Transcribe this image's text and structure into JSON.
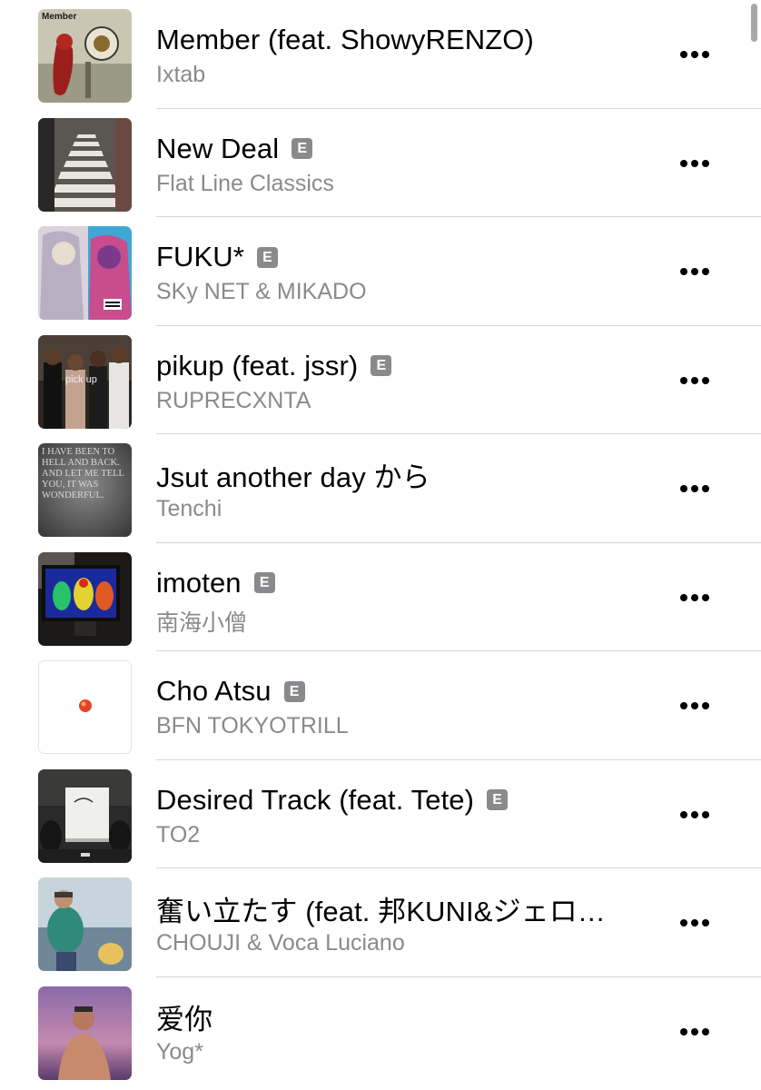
{
  "tracks": [
    {
      "title": "Member (feat. ShowyRENZO)",
      "artist": "Ixtab",
      "explicit": false,
      "artwork_label": "Member"
    },
    {
      "title": "New Deal",
      "artist": "Flat Line Classics",
      "explicit": true,
      "explicit_label": "E"
    },
    {
      "title": "FUKU*",
      "artist": "SKy NET & MIKADO",
      "explicit": true,
      "explicit_label": "E"
    },
    {
      "title": "pikup (feat. jssr)",
      "artist": "RUPRECXNTA",
      "explicit": true,
      "explicit_label": "E",
      "artwork_label": "pick up"
    },
    {
      "title": "Jsut another day から",
      "artist": "Tenchi",
      "explicit": false,
      "artwork_text": "I HAVE BEEN TO HELL AND BACK. AND LET ME TELL YOU, IT WAS WONDERFUL."
    },
    {
      "title": "imoten",
      "artist": "南海小僧",
      "explicit": true,
      "explicit_label": "E"
    },
    {
      "title": "Cho Atsu",
      "artist": "BFN TOKYOTRILL",
      "explicit": true,
      "explicit_label": "E"
    },
    {
      "title": "Desired Track (feat. Tete)",
      "artist": "TO2",
      "explicit": true,
      "explicit_label": "E"
    },
    {
      "title": "奮い立たす (feat. 邦KUNI&ジェロ…",
      "artist": "CHOUJI & Voca Luciano",
      "explicit": false
    },
    {
      "title": "爱你",
      "artist": "Yog*",
      "explicit": false
    }
  ],
  "icons": {
    "more": "ellipsis-icon",
    "explicit": "explicit-badge"
  },
  "colors": {
    "title": "#000000",
    "artist": "#8a8a8e",
    "badge": "#8a8a8d",
    "separator": "#d6d6d8"
  }
}
